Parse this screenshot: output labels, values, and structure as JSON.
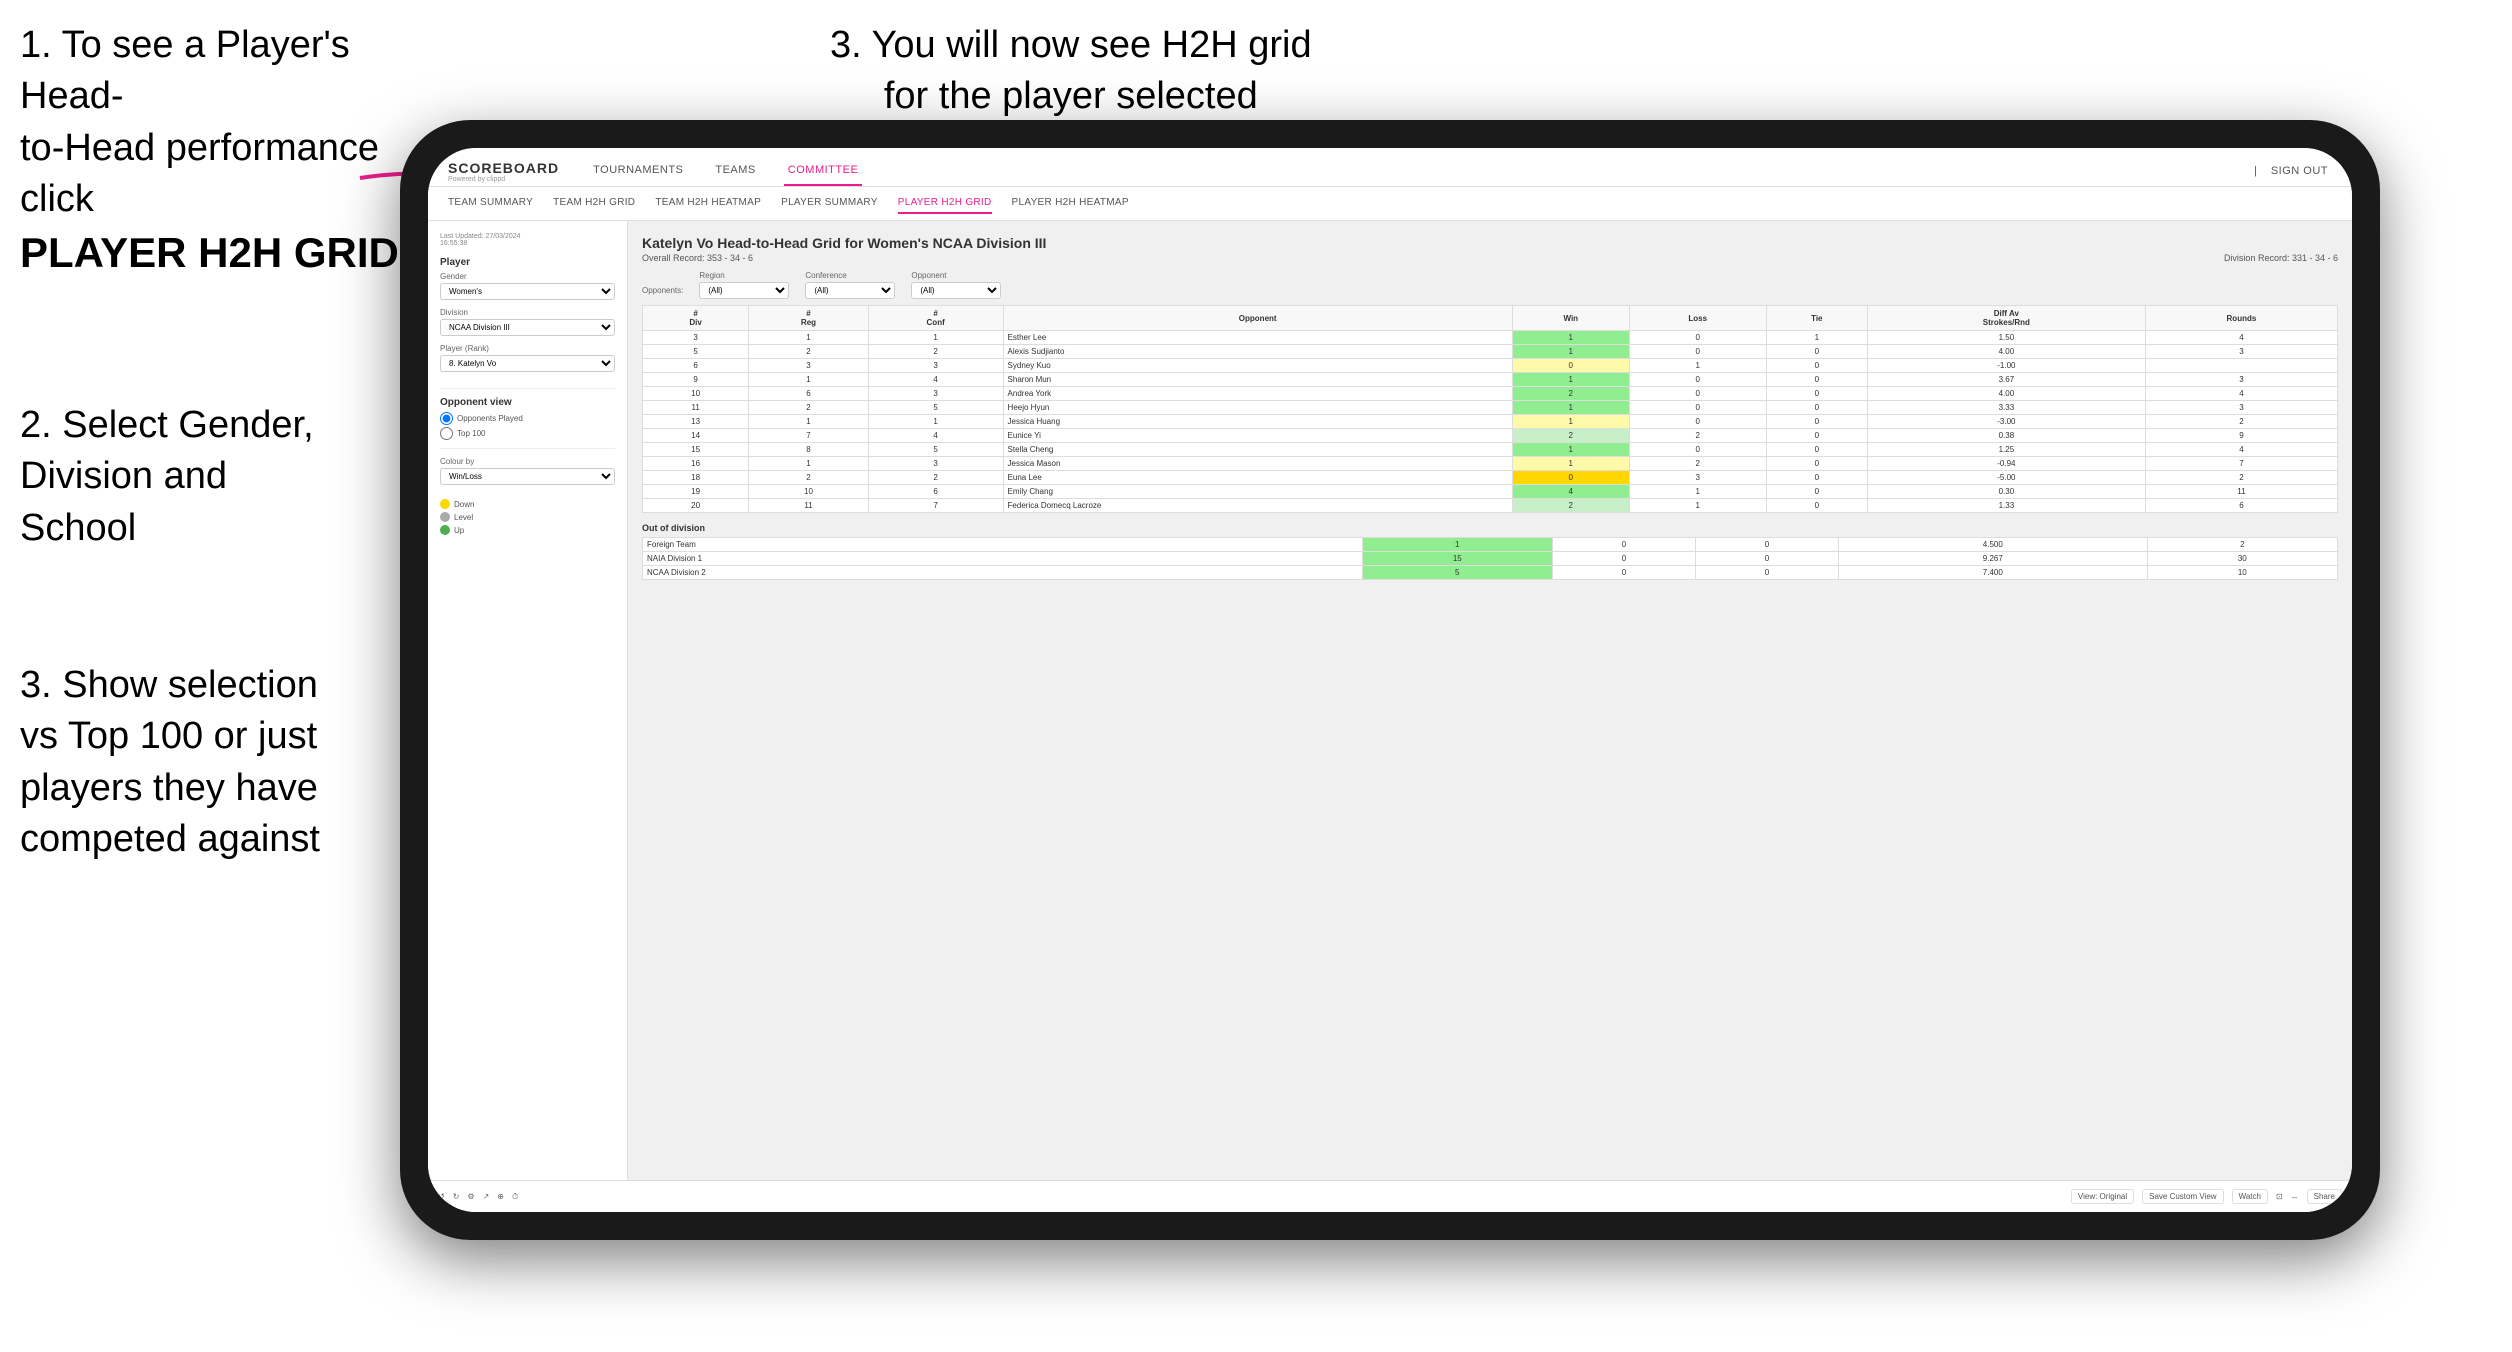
{
  "annotations": {
    "topleft_line1": "1. To see a Player's Head-",
    "topleft_line2": "to-Head performance click",
    "topleft_bold": "PLAYER H2H GRID",
    "topright": "3. You will now see H2H grid\nfor the player selected",
    "midleft": "2. Select Gender,\nDivision and\nSchool",
    "bottomleft": "3. Show selection\nvs Top 100 or just\nplayers they have\ncompeted against"
  },
  "nav": {
    "logo": "SCOREBOARD",
    "logo_sub": "Powered by clippd",
    "items": [
      "TOURNAMENTS",
      "TEAMS",
      "COMMITTEE"
    ],
    "active_item": "COMMITTEE",
    "sign_out": "Sign out"
  },
  "sub_nav": {
    "items": [
      "TEAM SUMMARY",
      "TEAM H2H GRID",
      "TEAM H2H HEATMAP",
      "PLAYER SUMMARY",
      "PLAYER H2H GRID",
      "PLAYER H2H HEATMAP"
    ],
    "active": "PLAYER H2H GRID"
  },
  "sidebar": {
    "timestamp": "Last Updated: 27/03/2024\n16:55:38",
    "player_section": "Player",
    "gender_label": "Gender",
    "gender_value": "Women's",
    "division_label": "Division",
    "division_value": "NCAA Division III",
    "player_rank_label": "Player (Rank)",
    "player_rank_value": "8. Katelyn Vo",
    "opponent_view_label": "Opponent view",
    "radio_opponents": "Opponents Played",
    "radio_top100": "Top 100",
    "colour_by_label": "Colour by",
    "colour_by_value": "Win/Loss",
    "legend": {
      "down": "Down",
      "level": "Level",
      "up": "Up"
    }
  },
  "main": {
    "title": "Katelyn Vo Head-to-Head Grid for Women's NCAA Division III",
    "overall_record": "Overall Record: 353 - 34 - 6",
    "division_record": "Division Record: 331 - 34 - 6",
    "filters": {
      "opponents_label": "Opponents:",
      "region_label": "Region",
      "region_value": "(All)",
      "conference_label": "Conference",
      "conference_value": "(All)",
      "opponent_label": "Opponent",
      "opponent_value": "(All)"
    },
    "table_headers": [
      "# Div",
      "# Reg",
      "# Conf",
      "Opponent",
      "Win",
      "Loss",
      "Tie",
      "Diff Av Strokes/Rnd",
      "Rounds"
    ],
    "rows": [
      {
        "div": "3",
        "reg": "1",
        "conf": "1",
        "opponent": "Esther Lee",
        "win": 1,
        "loss": 0,
        "tie": 1,
        "diff": "1.50",
        "rounds": 4,
        "win_color": "green"
      },
      {
        "div": "5",
        "reg": "2",
        "conf": "2",
        "opponent": "Alexis Sudjianto",
        "win": 1,
        "loss": 0,
        "tie": 0,
        "diff": "4.00",
        "rounds": 3,
        "win_color": "green"
      },
      {
        "div": "6",
        "reg": "3",
        "conf": "3",
        "opponent": "Sydney Kuo",
        "win": 0,
        "loss": 1,
        "tie": 0,
        "diff": "-1.00",
        "rounds": "",
        "win_color": "yellow"
      },
      {
        "div": "9",
        "reg": "1",
        "conf": "4",
        "opponent": "Sharon Mun",
        "win": 1,
        "loss": 0,
        "tie": 0,
        "diff": "3.67",
        "rounds": 3,
        "win_color": "green"
      },
      {
        "div": "10",
        "reg": "6",
        "conf": "3",
        "opponent": "Andrea York",
        "win": 2,
        "loss": 0,
        "tie": 0,
        "diff": "4.00",
        "rounds": 4,
        "win_color": "green"
      },
      {
        "div": "11",
        "reg": "2",
        "conf": "5",
        "opponent": "Heejo Hyun",
        "win": 1,
        "loss": 0,
        "tie": 0,
        "diff": "3.33",
        "rounds": 3,
        "win_color": "green"
      },
      {
        "div": "13",
        "reg": "1",
        "conf": "1",
        "opponent": "Jessica Huang",
        "win": 1,
        "loss": 0,
        "tie": 0,
        "diff": "-3.00",
        "rounds": 2,
        "win_color": "yellow"
      },
      {
        "div": "14",
        "reg": "7",
        "conf": "4",
        "opponent": "Eunice Yi",
        "win": 2,
        "loss": 2,
        "tie": 0,
        "diff": "0.38",
        "rounds": 9,
        "win_color": "light-green"
      },
      {
        "div": "15",
        "reg": "8",
        "conf": "5",
        "opponent": "Stella Cheng",
        "win": 1,
        "loss": 0,
        "tie": 0,
        "diff": "1.25",
        "rounds": 4,
        "win_color": "green"
      },
      {
        "div": "16",
        "reg": "1",
        "conf": "3",
        "opponent": "Jessica Mason",
        "win": 1,
        "loss": 2,
        "tie": 0,
        "diff": "-0.94",
        "rounds": 7,
        "win_color": "yellow"
      },
      {
        "div": "18",
        "reg": "2",
        "conf": "2",
        "opponent": "Euna Lee",
        "win": 0,
        "loss": 3,
        "tie": 0,
        "diff": "-5.00",
        "rounds": 2,
        "win_color": "orange"
      },
      {
        "div": "19",
        "reg": "10",
        "conf": "6",
        "opponent": "Emily Chang",
        "win": 4,
        "loss": 1,
        "tie": 0,
        "diff": "0.30",
        "rounds": 11,
        "win_color": "green"
      },
      {
        "div": "20",
        "reg": "11",
        "conf": "7",
        "opponent": "Federica Domecq Lacroze",
        "win": 2,
        "loss": 1,
        "tie": 0,
        "diff": "1.33",
        "rounds": 6,
        "win_color": "light-green"
      }
    ],
    "out_of_division_title": "Out of division",
    "out_of_division_rows": [
      {
        "opponent": "Foreign Team",
        "win": 1,
        "loss": 0,
        "tie": 0,
        "diff": "4.500",
        "rounds": 2,
        "win_color": "green"
      },
      {
        "opponent": "NAIA Division 1",
        "win": 15,
        "loss": 0,
        "tie": 0,
        "diff": "9.267",
        "rounds": 30,
        "win_color": "green"
      },
      {
        "opponent": "NCAA Division 2",
        "win": 5,
        "loss": 0,
        "tie": 0,
        "diff": "7.400",
        "rounds": 10,
        "win_color": "green"
      }
    ]
  },
  "toolbar": {
    "undo": "↺",
    "redo": "↻",
    "view_original": "View: Original",
    "save_custom_view": "Save Custom View",
    "watch": "Watch",
    "share": "Share"
  }
}
